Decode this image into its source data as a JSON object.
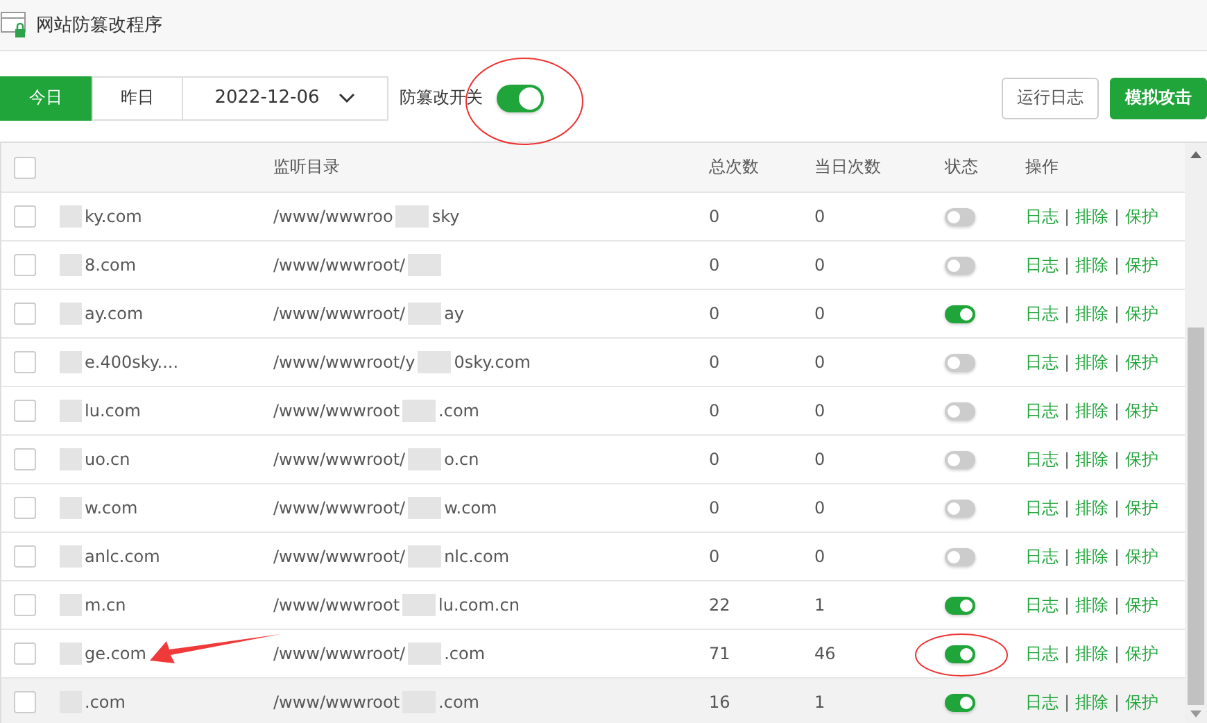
{
  "window": {
    "title": "网站防篡改程序"
  },
  "toolbar": {
    "tabs": [
      {
        "label": "今日",
        "selected": true
      },
      {
        "label": "昨日",
        "selected": false
      }
    ],
    "date": "2022-12-06",
    "switch_label": "防篡改开关",
    "switch_on": true,
    "switch_circled": true,
    "buttons": [
      {
        "label": "运行日志",
        "kind": "plain"
      },
      {
        "label": "模拟攻击",
        "kind": "primary"
      }
    ]
  },
  "table": {
    "all_checked": false,
    "columns": [
      "监听目录",
      "总次数",
      "当日次数",
      "状态",
      "操作"
    ],
    "rows": [
      {
        "checked": false,
        "site": "ky.com",
        "dir": "/www/wwwroo",
        "dir_end": "sky",
        "total": "0",
        "today": "0",
        "on": false,
        "hover": false,
        "marked": false,
        "actions": [
          "日志",
          "|",
          "排除",
          "|",
          "保护"
        ]
      },
      {
        "checked": false,
        "site": "8.com",
        "dir": "/www/wwwroot/",
        "total": "0",
        "today": "0",
        "on": false,
        "hover": false,
        "marked": false,
        "actions": [
          "日志",
          "|",
          "排除",
          "|",
          "保护"
        ]
      },
      {
        "checked": false,
        "site": "ay.com",
        "dir": "/www/wwwroot/",
        "dir_end": "ay",
        "total": "0",
        "today": "0",
        "on": true,
        "hover": false,
        "marked": false,
        "actions": [
          "日志",
          "|",
          "排除",
          "|",
          "保护"
        ]
      },
      {
        "checked": false,
        "site": "e.400sky....",
        "dir": "/www/wwwroot/y",
        "dir_end": "0sky.com",
        "total": "0",
        "today": "0",
        "on": false,
        "hover": false,
        "marked": false,
        "actions": [
          "日志",
          "|",
          "排除",
          "|",
          "保护"
        ]
      },
      {
        "checked": false,
        "site": "lu.com",
        "dir": "/www/wwwroot",
        "dir_end": ".com",
        "total": "0",
        "today": "0",
        "on": false,
        "hover": false,
        "marked": false,
        "actions": [
          "日志",
          "|",
          "排除",
          "|",
          "保护"
        ]
      },
      {
        "checked": false,
        "site": "uo.cn",
        "dir": "/www/wwwroot/",
        "dir_end": "o.cn",
        "total": "0",
        "today": "0",
        "on": false,
        "hover": false,
        "marked": false,
        "actions": [
          "日志",
          "|",
          "排除",
          "|",
          "保护"
        ]
      },
      {
        "checked": false,
        "site": "w.com",
        "dir": "/www/wwwroot/",
        "dir_end": "w.com",
        "total": "0",
        "today": "0",
        "on": false,
        "hover": false,
        "marked": false,
        "actions": [
          "日志",
          "|",
          "排除",
          "|",
          "保护"
        ]
      },
      {
        "checked": false,
        "site": "anlc.com",
        "dir": "/www/wwwroot/",
        "dir_end": "nlc.com",
        "total": "0",
        "today": "0",
        "on": false,
        "hover": false,
        "marked": false,
        "actions": [
          "日志",
          "|",
          "排除",
          "|",
          "保护"
        ]
      },
      {
        "checked": false,
        "site": "m.cn",
        "dir": "/www/wwwroot",
        "dir_end": "lu.com.cn",
        "total": "22",
        "today": "1",
        "on": true,
        "hover": false,
        "marked": false,
        "actions": [
          "日志",
          "|",
          "排除",
          "|",
          "保护"
        ]
      },
      {
        "checked": false,
        "site": "ge.com",
        "dir": "/www/wwwroot/",
        "dir_end": ".com",
        "total": "71",
        "today": "46",
        "on": true,
        "hover": false,
        "marked": true,
        "actions": [
          "日志",
          "|",
          "排除",
          "|",
          "保护"
        ]
      },
      {
        "checked": false,
        "site": ".com",
        "dir": "/www/wwwroot",
        "dir_end": ".com",
        "total": "16",
        "today": "1",
        "on": true,
        "hover": true,
        "marked": false,
        "actions": [
          "日志",
          "|",
          "排除",
          "|",
          "保护"
        ]
      }
    ]
  }
}
